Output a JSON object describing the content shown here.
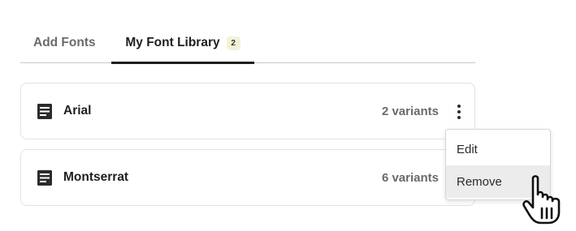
{
  "tabs": [
    {
      "label": "Add Fonts",
      "active": false
    },
    {
      "label": "My Font Library",
      "active": true,
      "badge": "2"
    }
  ],
  "fonts": [
    {
      "name": "Arial",
      "variants": "2 variants",
      "icon": "document-icon"
    },
    {
      "name": "Montserrat",
      "variants": "6 variants",
      "icon": "document-icon"
    }
  ],
  "context_menu": {
    "items": [
      {
        "label": "Edit",
        "hovered": false
      },
      {
        "label": "Remove",
        "hovered": true
      }
    ]
  },
  "cursor": {
    "icon": "hand-pointer-icon"
  },
  "colors": {
    "badge_bg": "#f4f2d6",
    "active_underline": "#1e1e1e",
    "hover_bg": "#ececec"
  }
}
